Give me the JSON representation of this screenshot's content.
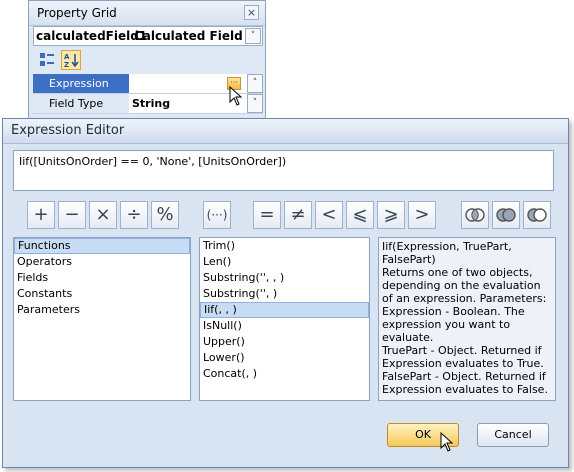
{
  "property_grid": {
    "title": "Property Grid",
    "close_glyph": "×",
    "object_name": "calculatedField1",
    "object_type": "Calculated Field",
    "dropdown_glyph": "˅",
    "rows": [
      {
        "label": "Expression",
        "value": ""
      },
      {
        "label": "Field Type",
        "value": "String"
      }
    ],
    "ellipsis_glyph": "···",
    "scroll_up_glyph": "˄",
    "scroll_down_glyph": "˅",
    "icons": [
      "categorized-icon",
      "alphabetical-sort-icon"
    ],
    "selected_toolbar_color": "#ffe7a6",
    "selected_row_color": "#3d6fc4"
  },
  "expression_editor": {
    "title": "Expression Editor",
    "expression": "Iif([UnitsOnOrder] == 0, 'None', [UnitsOnOrder])",
    "operators": [
      "+",
      "−",
      "×",
      "÷",
      "%",
      "(···)",
      "=",
      "≠",
      "<",
      "⩽",
      "⩾",
      ">"
    ],
    "logical_icons": [
      "and-operator-icon",
      "or-operator-icon",
      "not-operator-icon"
    ],
    "categories": [
      "Functions",
      "Operators",
      "Fields",
      "Constants",
      "Parameters"
    ],
    "selected_category": "Functions",
    "functions": [
      "Trim()",
      "Len()",
      "Substring('', , )",
      "Substring('', )",
      "Iif(, , )",
      "IsNull()",
      "Upper()",
      "Lower()",
      "Concat(, )"
    ],
    "selected_function": "Iif(, , )",
    "description": "Iif(Expression, TruePart, FalsePart)\nReturns one of two objects, depending on the evaluation of an expression. Parameters:\nExpression - Boolean. The expression you want to evaluate.\nTruePart - Object. Returned if Expression evaluates to True.\nFalsePart - Object. Returned if Expression evaluates to False.",
    "ok_label": "OK",
    "cancel_label": "Cancel",
    "accent_color": "#f6c858"
  }
}
